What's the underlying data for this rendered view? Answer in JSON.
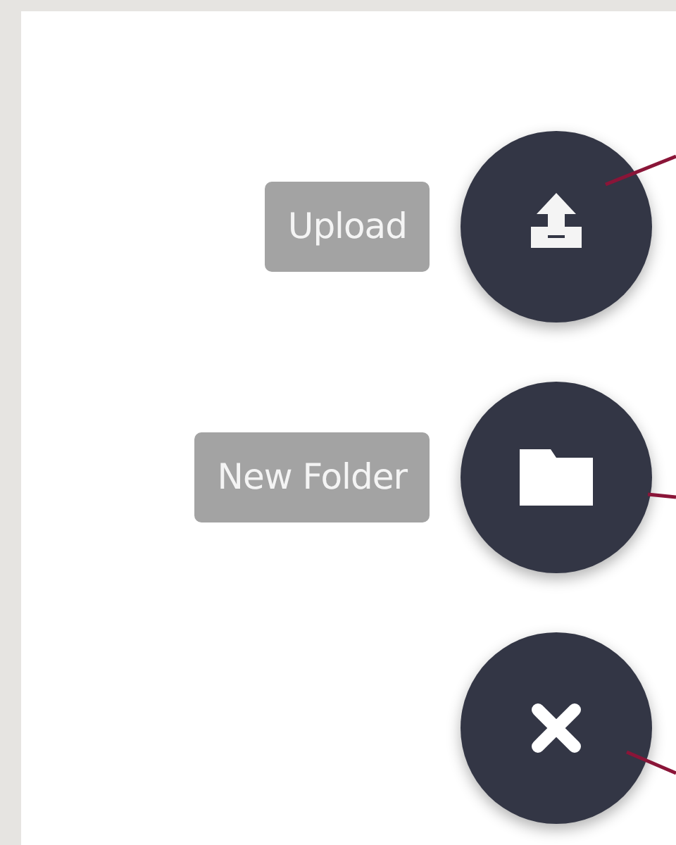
{
  "actions": [
    {
      "kind": "upload",
      "label": "Upload"
    },
    {
      "kind": "folder",
      "label": "New Folder"
    },
    {
      "kind": "close"
    }
  ]
}
